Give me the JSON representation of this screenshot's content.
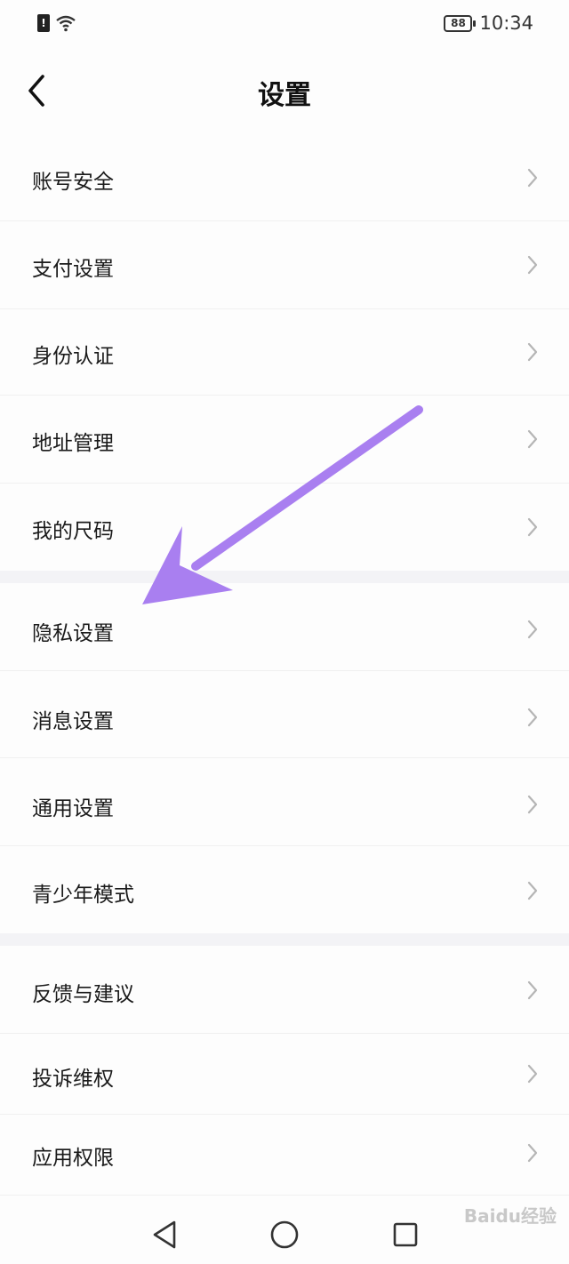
{
  "status_bar": {
    "sim_label": "!",
    "battery": "88",
    "time": "10:34"
  },
  "header": {
    "title": "设置"
  },
  "settings_items": [
    {
      "label": "账号安全"
    },
    {
      "label": "支付设置"
    },
    {
      "label": "身份认证"
    },
    {
      "label": "地址管理"
    },
    {
      "label": "我的尺码"
    },
    {
      "label": "隐私设置"
    },
    {
      "label": "消息设置"
    },
    {
      "label": "通用设置"
    },
    {
      "label": "青少年模式"
    },
    {
      "label": "反馈与建议"
    },
    {
      "label": "投诉维权"
    },
    {
      "label": "应用权限"
    }
  ],
  "annotation": {
    "arrow_color": "#a97ff0"
  },
  "watermark": "Baidu经验"
}
